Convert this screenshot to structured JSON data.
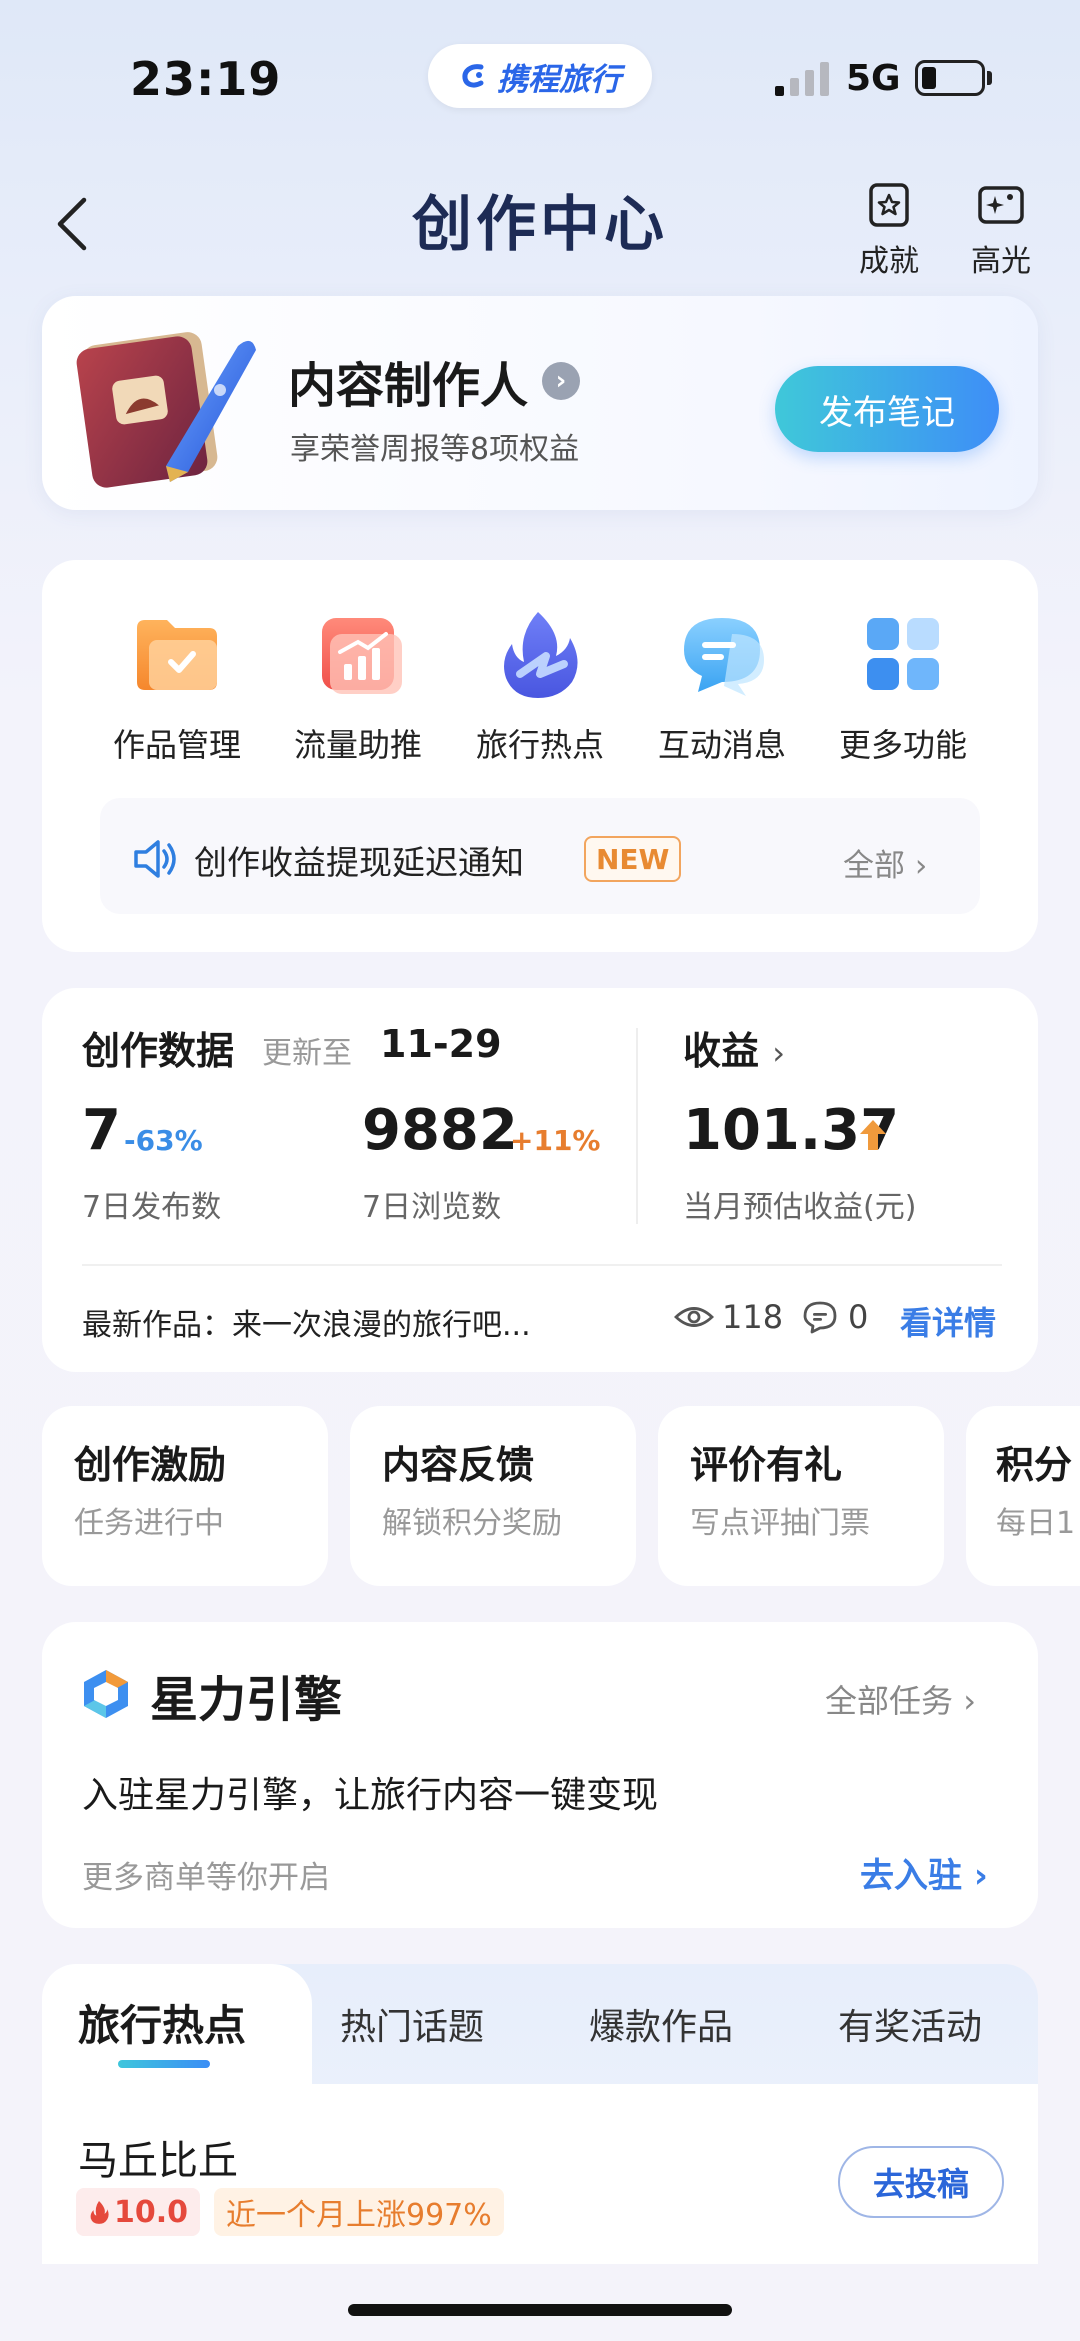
{
  "status_bar": {
    "time": "23:19",
    "app_badge": "携程旅行",
    "network": "5G",
    "signal_icon": "signal-icon",
    "battery_icon": "battery-icon"
  },
  "nav": {
    "title": "创作中心",
    "back_icon": "chevron-left-icon",
    "achievements_label": "成就",
    "highlights_label": "高光"
  },
  "creator": {
    "name": "内容制作人",
    "subtitle": "享荣誉周报等8项权益",
    "publish_button": "发布笔记"
  },
  "features": [
    {
      "label": "作品管理",
      "icon": "folder-icon"
    },
    {
      "label": "流量助推",
      "icon": "chart-boost-icon"
    },
    {
      "label": "旅行热点",
      "icon": "flame-icon"
    },
    {
      "label": "互动消息",
      "icon": "chat-bubble-icon"
    },
    {
      "label": "更多功能",
      "icon": "grid-icon"
    }
  ],
  "notice": {
    "text": "创作收益提现延迟通知",
    "badge": "NEW",
    "all_label": "全部",
    "icon": "speaker-icon"
  },
  "creation_data": {
    "title": "创作数据",
    "updated_label": "更新至",
    "updated_date": "11-29",
    "posts": {
      "value": "7",
      "change": "-63%",
      "label": "7日发布数"
    },
    "views": {
      "value": "9882",
      "change": "+11%",
      "label": "7日浏览数"
    },
    "income_title": "收益",
    "income": {
      "value": "101.37",
      "label": "当月预估收益(元)"
    },
    "latest_label": "最新作品：来一次浪漫的旅行吧...",
    "latest_views": "118",
    "latest_comments": "0",
    "detail_link": "看详情"
  },
  "tasks": [
    {
      "title": "创作激励",
      "sub": "任务进行中"
    },
    {
      "title": "内容反馈",
      "sub": "解锁积分奖励"
    },
    {
      "title": "评价有礼",
      "sub": "写点评抽门票"
    },
    {
      "title": "积分",
      "sub": "每日1"
    }
  ],
  "xingli": {
    "title": "星力引擎",
    "all_tasks": "全部任务",
    "desc": "入驻星力引擎，让旅行内容一键变现",
    "more": "更多商单等你开启",
    "join": "去入驻"
  },
  "hot": {
    "tabs": [
      "旅行热点",
      "热门话题",
      "爆款作品",
      "有奖活动"
    ],
    "item_title": "马丘比丘",
    "heat": "10.0",
    "rise": "近一个月上涨997%",
    "submit": "去投稿"
  },
  "colors": {
    "accent_blue": "#3a7de6",
    "accent_orange": "#e77d2e",
    "publish_gradient_start": "#3fc8d9",
    "publish_gradient_end": "#3e8ef7"
  }
}
